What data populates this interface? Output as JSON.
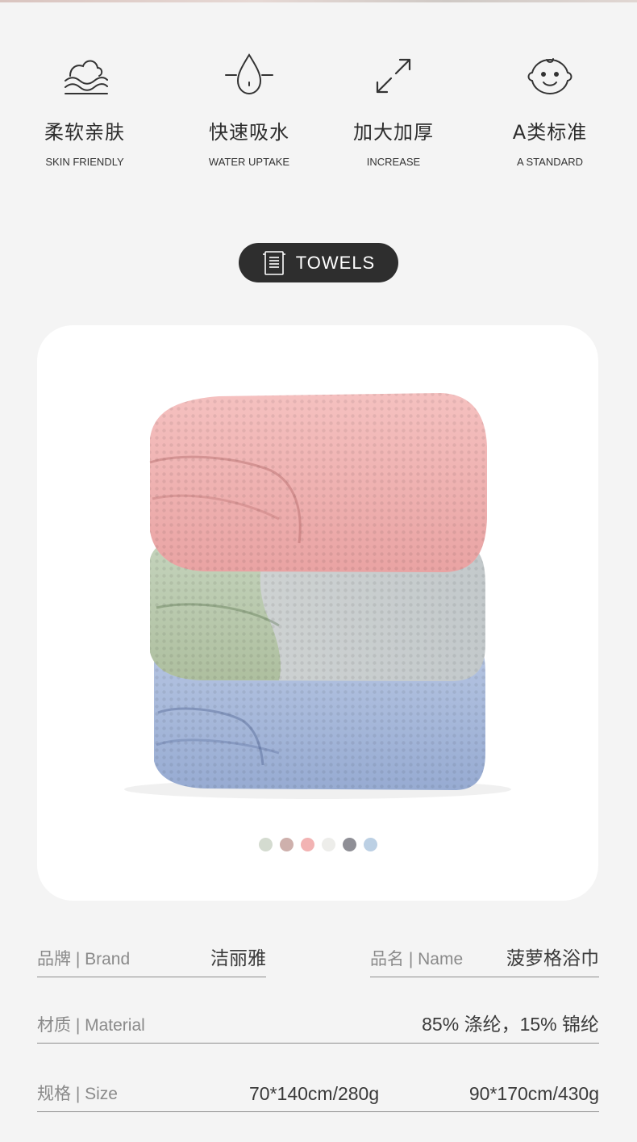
{
  "features": [
    {
      "icon": "waves-icon",
      "cn": "柔软亲肤",
      "en": "SKIN FRIENDLY"
    },
    {
      "icon": "water-drop-icon",
      "cn": "快速吸水",
      "en": "WATER UPTAKE"
    },
    {
      "icon": "expand-arrows-icon",
      "cn": "加大加厚",
      "en": "INCREASE"
    },
    {
      "icon": "baby-face-icon",
      "cn": "A类标准",
      "en": "A STANDARD"
    }
  ],
  "section": {
    "icon": "towel-icon",
    "label": "TOWELS"
  },
  "product": {
    "image": "stacked-towels-image",
    "swatches": [
      "#d4dbd0",
      "#ceb0ac",
      "#f2b3b3",
      "#ededea",
      "#8f8f96",
      "#bcd0e4"
    ]
  },
  "specs": {
    "brand_label": "品牌 | Brand",
    "brand_value": "洁丽雅",
    "name_label": "品名 | Name",
    "name_value": "菠萝格浴巾",
    "material_label": "材质 | Material",
    "material_value": "85% 涤纶，15% 锦纶",
    "size_label": "规格 | Size",
    "size_value_1": "70*140cm/280g",
    "size_value_2": "90*170cm/430g"
  }
}
